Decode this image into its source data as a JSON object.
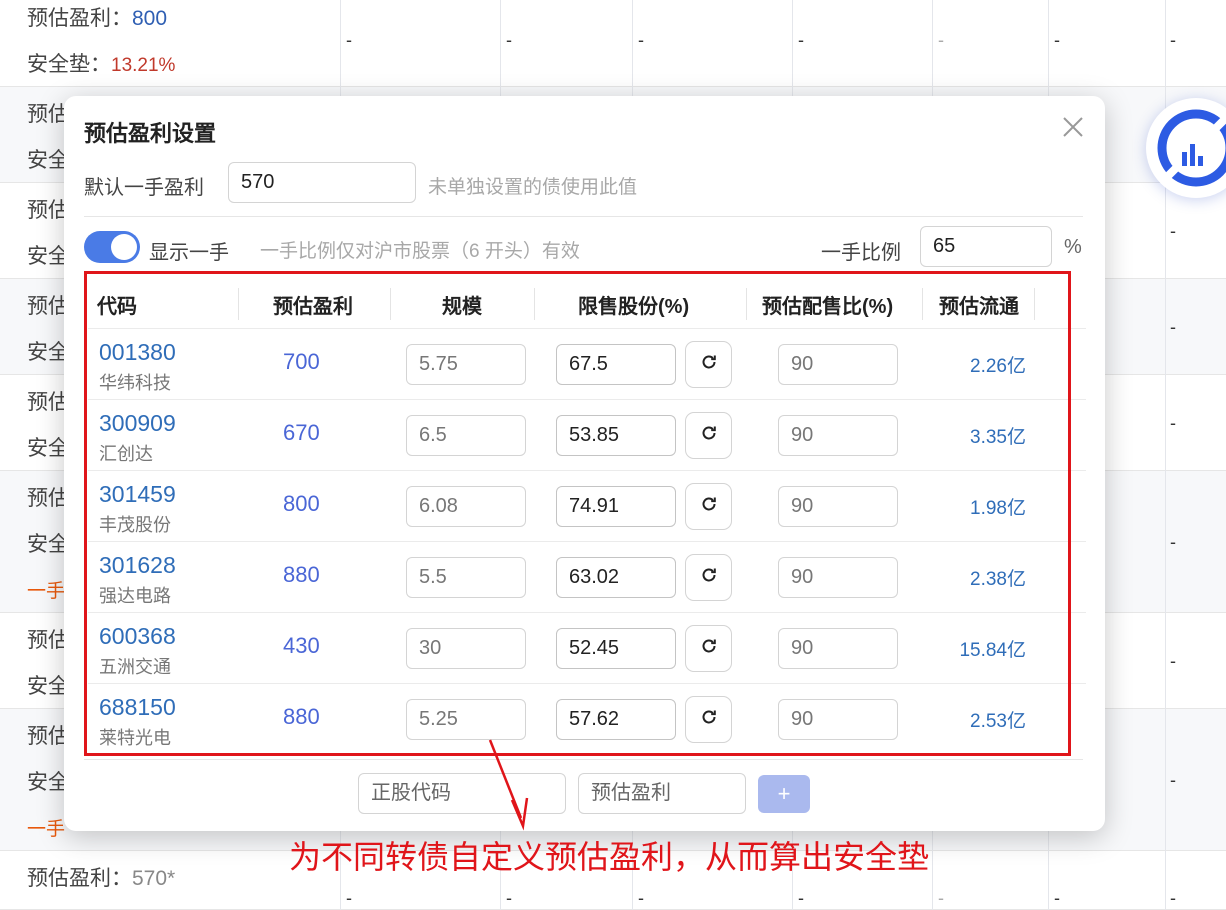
{
  "background": {
    "row1": {
      "profit_label": "预估盈利：",
      "profit_value": "800",
      "safety_label": "安全垫：",
      "safety_value": "13.21%"
    },
    "row_partial": {
      "profit": "预估",
      "safety": "安全"
    },
    "warning_partial": "一手",
    "warning_partial2": "一手",
    "last_row": {
      "profit_label": "预估盈利：",
      "profit_value": "570*"
    },
    "dash": "-"
  },
  "modal": {
    "title": "预估盈利设置",
    "default_label": "默认一手盈利",
    "default_value": "570",
    "default_hint": "未单独设置的债使用此值",
    "toggle_label": "显示一手",
    "toggle_hint": "一手比例仅对沪市股票（6 开头）有效",
    "ratio_label": "一手比例",
    "ratio_value": "65",
    "ratio_unit": "%",
    "columns": [
      "代码",
      "预估盈利",
      "规模",
      "限售股份(%)",
      "预估配售比(%)",
      "预估流通"
    ],
    "rows": [
      {
        "code": "001380",
        "name": "华纬科技",
        "profit": "700",
        "scale": "5.75",
        "locked": "67.5",
        "ratio": "90",
        "float": "2.26亿"
      },
      {
        "code": "300909",
        "name": "汇创达",
        "profit": "670",
        "scale": "6.5",
        "locked": "53.85",
        "ratio": "90",
        "float": "3.35亿"
      },
      {
        "code": "301459",
        "name": "丰茂股份",
        "profit": "800",
        "scale": "6.08",
        "locked": "74.91",
        "ratio": "90",
        "float": "1.98亿"
      },
      {
        "code": "301628",
        "name": "强达电路",
        "profit": "880",
        "scale": "5.5",
        "locked": "63.02",
        "ratio": "90",
        "float": "2.38亿"
      },
      {
        "code": "600368",
        "name": "五洲交通",
        "profit": "430",
        "scale": "30",
        "locked": "52.45",
        "ratio": "90",
        "float": "15.84亿"
      },
      {
        "code": "688150",
        "name": "莱特光电",
        "profit": "880",
        "scale": "5.25",
        "locked": "57.62",
        "ratio": "90",
        "float": "2.53亿"
      }
    ],
    "add_code_placeholder": "正股代码",
    "add_profit_placeholder": "预估盈利",
    "add_button": "+"
  },
  "annotation": "为不同转债自定义预估盈利，从而算出安全垫",
  "colors": {
    "accent": "#4a7be6",
    "annotation_red": "#e0151a",
    "link_blue": "#2f6db8"
  }
}
